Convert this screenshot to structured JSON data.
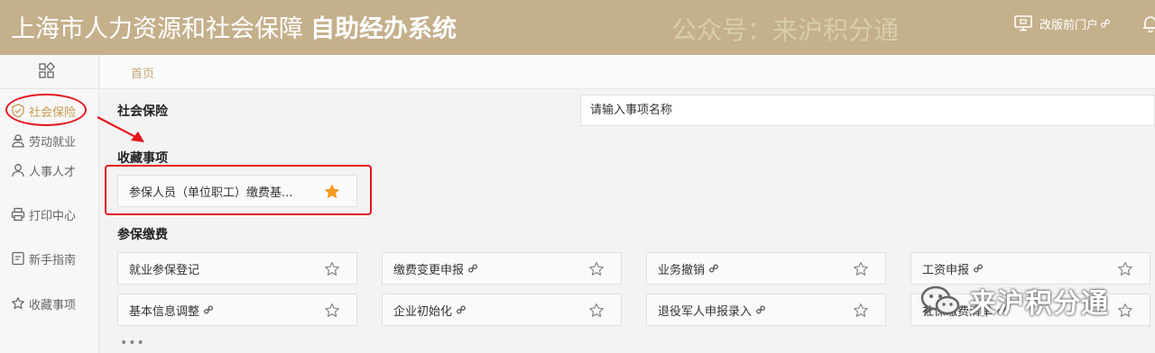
{
  "header": {
    "title": "上海市人力资源和社会保障",
    "subtitle": "自助经办系统",
    "watermark": "公众号：来沪积分通",
    "portal_label": "改版前门户"
  },
  "sidebar": {
    "items": [
      {
        "label": "社会保险",
        "icon": "shield-icon",
        "active": true
      },
      {
        "label": "劳动就业",
        "icon": "worker-icon"
      },
      {
        "label": "人事人才",
        "icon": "person-icon"
      },
      {
        "label": "打印中心",
        "icon": "printer-icon"
      },
      {
        "label": "新手指南",
        "icon": "guide-icon"
      },
      {
        "label": "收藏事项",
        "icon": "star-outline-icon"
      }
    ]
  },
  "breadcrumb": {
    "home": "首页"
  },
  "main": {
    "page_title": "社会保险",
    "search_placeholder": "请输入事项名称",
    "favorites": {
      "title": "收藏事项",
      "items": [
        {
          "label": "参保人员（单位职工）缴费基...",
          "starred": true
        }
      ]
    },
    "payment": {
      "title": "参保缴费",
      "items": [
        {
          "label": "就业参保登记",
          "link": false
        },
        {
          "label": "缴费变更申报",
          "link": true
        },
        {
          "label": "业务撤销",
          "link": true
        },
        {
          "label": "工资申报",
          "link": true
        },
        {
          "label": "基本信息调整",
          "link": true
        },
        {
          "label": "企业初始化",
          "link": true
        },
        {
          "label": "退役军人申报录入",
          "link": true
        },
        {
          "label": "社保缴费清单",
          "link": true
        }
      ]
    },
    "more": "•••"
  },
  "watermark_bottom": "来沪积分通",
  "colors": {
    "header_bg": "#c5b08c",
    "accent": "#c79a4e",
    "highlight_red": "#e3141e",
    "star_filled": "#f59a23"
  }
}
